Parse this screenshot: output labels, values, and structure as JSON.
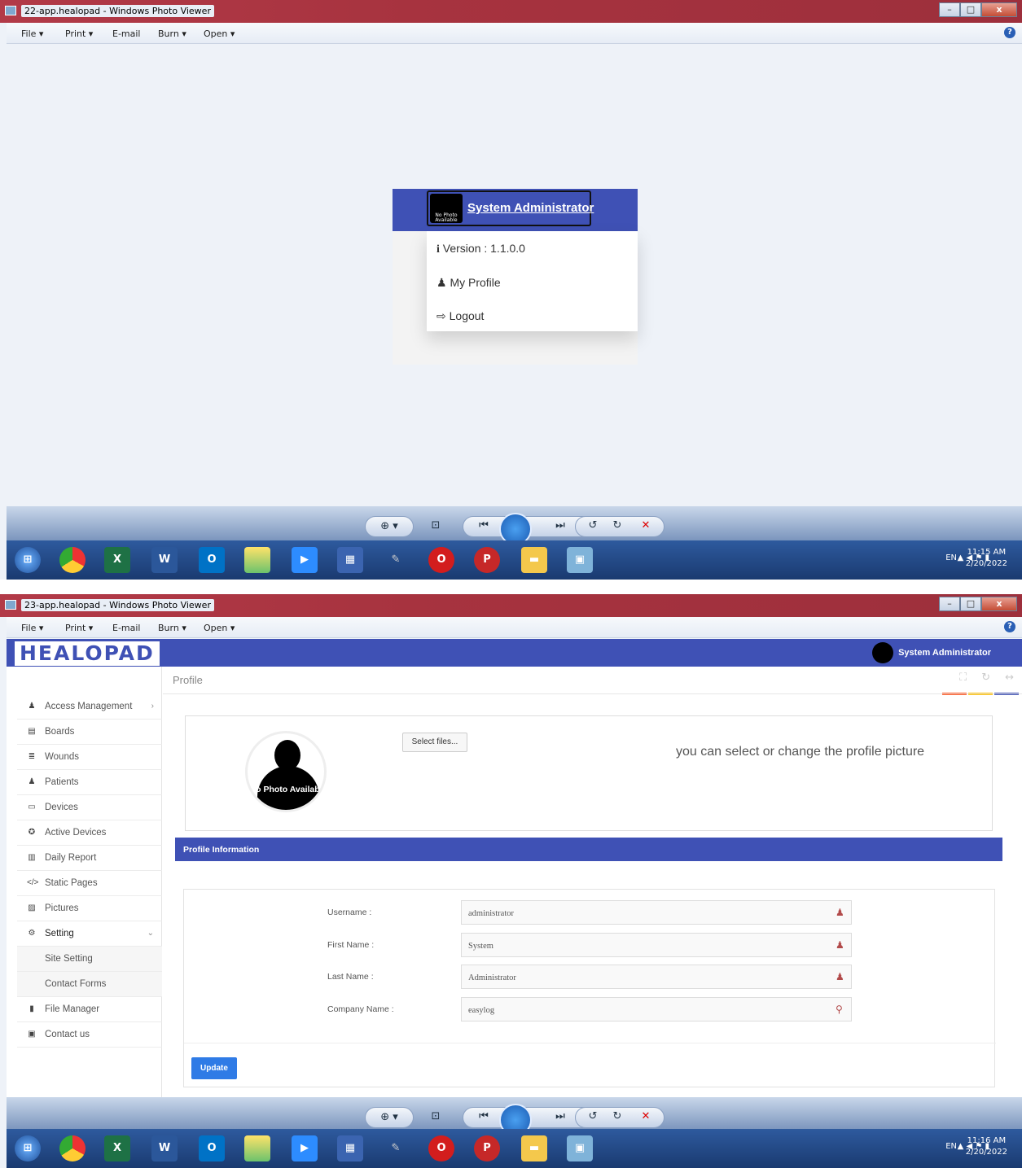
{
  "shot1": {
    "window_title": "22-app.healopad - Windows Photo Viewer",
    "menu": [
      "File",
      "Print",
      "E-mail",
      "Burn",
      "Open"
    ],
    "popup": {
      "user_name": "System Administrator",
      "avatar_text": "No Photo Available",
      "items": [
        {
          "icon": "info-icon",
          "label": "Version : 1.1.0.0"
        },
        {
          "icon": "user-icon",
          "label": "My Profile"
        },
        {
          "icon": "logout-icon",
          "label": "Logout"
        }
      ]
    },
    "tray": {
      "lang": "EN",
      "time": "11:15 AM",
      "date": "2/20/2022"
    }
  },
  "shot2": {
    "window_title": "23-app.healopad - Windows Photo Viewer",
    "menu": [
      "File",
      "Print",
      "E-mail",
      "Burn",
      "Open"
    ],
    "app": {
      "logo": "HEALOPAD",
      "header_user": "System Administrator",
      "page_title": "Profile",
      "sidebar": [
        {
          "icon": "user-icon",
          "label": "Access Management",
          "chevron": "›"
        },
        {
          "icon": "board-icon",
          "label": "Boards"
        },
        {
          "icon": "database-icon",
          "label": "Wounds"
        },
        {
          "icon": "users-icon",
          "label": "Patients"
        },
        {
          "icon": "device-icon",
          "label": "Devices"
        },
        {
          "icon": "active-device-icon",
          "label": "Active Devices"
        },
        {
          "icon": "chart-icon",
          "label": "Daily Report"
        },
        {
          "icon": "code-icon",
          "label": "Static Pages"
        },
        {
          "icon": "picture-icon",
          "label": "Pictures"
        },
        {
          "icon": "gears-icon",
          "label": "Setting",
          "chevron": "⌄"
        },
        {
          "label": "Site Setting",
          "sub": true
        },
        {
          "label": "Contact Forms",
          "sub": true
        },
        {
          "icon": "file-icon",
          "label": "File Manager"
        },
        {
          "icon": "contact-icon",
          "label": "Contact us"
        }
      ],
      "select_files": "Select files...",
      "hint": "you can select or change the profile picture",
      "avatar_text": "No Photo Available",
      "section_title": "Profile Information",
      "fields": [
        {
          "label": "Username :",
          "value": "administrator",
          "icon": "user-icon"
        },
        {
          "label": "First Name :",
          "value": "System",
          "icon": "user-icon"
        },
        {
          "label": "Last Name :",
          "value": "Administrator",
          "icon": "user-icon"
        },
        {
          "label": "Company Name :",
          "value": "easylog",
          "icon": "map-marker-icon"
        }
      ],
      "update_label": "Update",
      "accent_colors": [
        "#ff5722",
        "#ffc107",
        "#3f51b5"
      ]
    },
    "tray": {
      "lang": "EN",
      "time": "11:16 AM",
      "date": "2/20/2022"
    }
  },
  "colors": {
    "primary": "#3f51b5",
    "button": "#2f7be6"
  }
}
